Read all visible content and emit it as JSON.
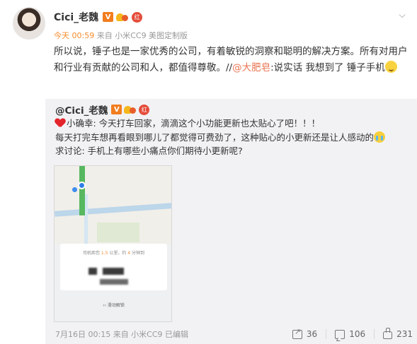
{
  "post": {
    "author": "Cici_老魏",
    "meta": {
      "time": "今天 00:59",
      "source_prefix": " 来自 ",
      "source": "小米CC9 美图定制版"
    },
    "content": {
      "text": "所以说，锤子也是一家优秀的公司，有着敏锐的洞察和聪明的解决方案。所有对用户和行业有贡献的公司和人，都值得尊敬。//",
      "mention": "@大肥皂",
      "rest": ":说实话 我想到了 锤子手机"
    }
  },
  "repost": {
    "author": "@Cici_老魏",
    "lines": {
      "line1": "小确幸: 今天打车回家，滴滴这个小功能更新也太贴心了吧！！！",
      "line2": "每天打完车想再看眼到哪儿了都觉得可费劲了，这种贴心的小更新还是让人感动的",
      "line3": "求讨论: 手机上有哪些小痛点你们期待小更新呢?"
    },
    "phone": {
      "card_prefix": "司机距您 ",
      "distance": "1.5",
      "card_mid": " 公里，约 ",
      "minutes": "4",
      "card_suffix": " 分钟到",
      "slide_label": "滑动解锁"
    },
    "footer": {
      "date": "7月16日 00:15 来自 小米CC9 已编辑",
      "share_count": "36",
      "comment_count": "106",
      "like_count": "231"
    }
  },
  "colors": {
    "accent": "#eb7350",
    "time": "#f68c2c",
    "repost_bg": "#f2f2f5"
  }
}
